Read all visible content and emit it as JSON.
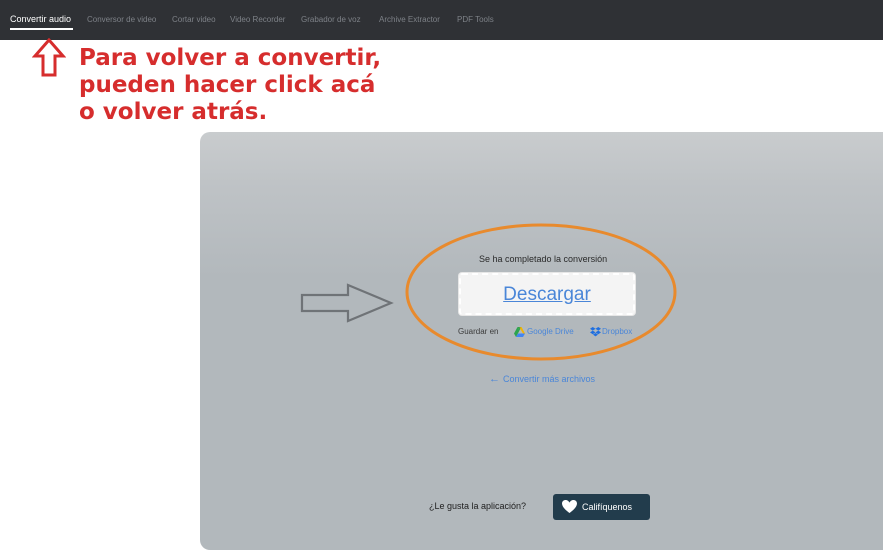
{
  "nav": {
    "items": [
      {
        "label": "Convertir audio",
        "active": true
      },
      {
        "label": "Conversor de video"
      },
      {
        "label": "Cortar video"
      },
      {
        "label": "Video Recorder"
      },
      {
        "label": "Grabador de voz"
      },
      {
        "label": "Archive Extractor"
      },
      {
        "label": "PDF Tools"
      }
    ]
  },
  "annotation": {
    "lines": [
      "Para volver a convertir,",
      "pueden hacer click acá",
      "o volver atrás."
    ],
    "color": "#d62d2d"
  },
  "result": {
    "done_text": "Se ha completado la conversión",
    "download_label": "Descargar",
    "save_in_label": "Guardar en",
    "google_drive_label": "Google Drive",
    "dropbox_label": "Dropbox",
    "convert_more_label": "Convertir más archivos"
  },
  "rating": {
    "question": "¿Le gusta la aplicación?",
    "button_label": "Califíquenos"
  },
  "colors": {
    "navbar": "#2f3135",
    "link": "#4a86d8",
    "highlight_oval": "#e88a2d",
    "rate_button": "#223c4c"
  }
}
